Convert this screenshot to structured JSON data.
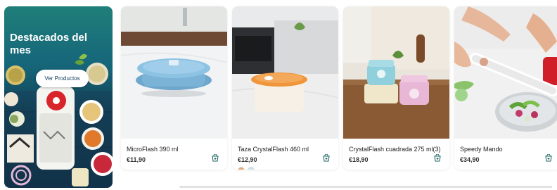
{
  "hero": {
    "title": "Destacados del mes",
    "button_label": "Ver Productos"
  },
  "products": [
    {
      "name": "MicroFlash 390 ml",
      "price": "€11,90"
    },
    {
      "name": "Taza CrystalFlash 460 ml",
      "price": "€12,90",
      "swatches": [
        "#e8a878",
        "#cfe3e8"
      ]
    },
    {
      "name": "CrystalFlash cuadrada 275 ml(3)",
      "price": "€18,90"
    },
    {
      "name": "Speedy Mando",
      "price": "€34,90"
    }
  ],
  "icons": {
    "cart": "add-to-cart-icon"
  }
}
